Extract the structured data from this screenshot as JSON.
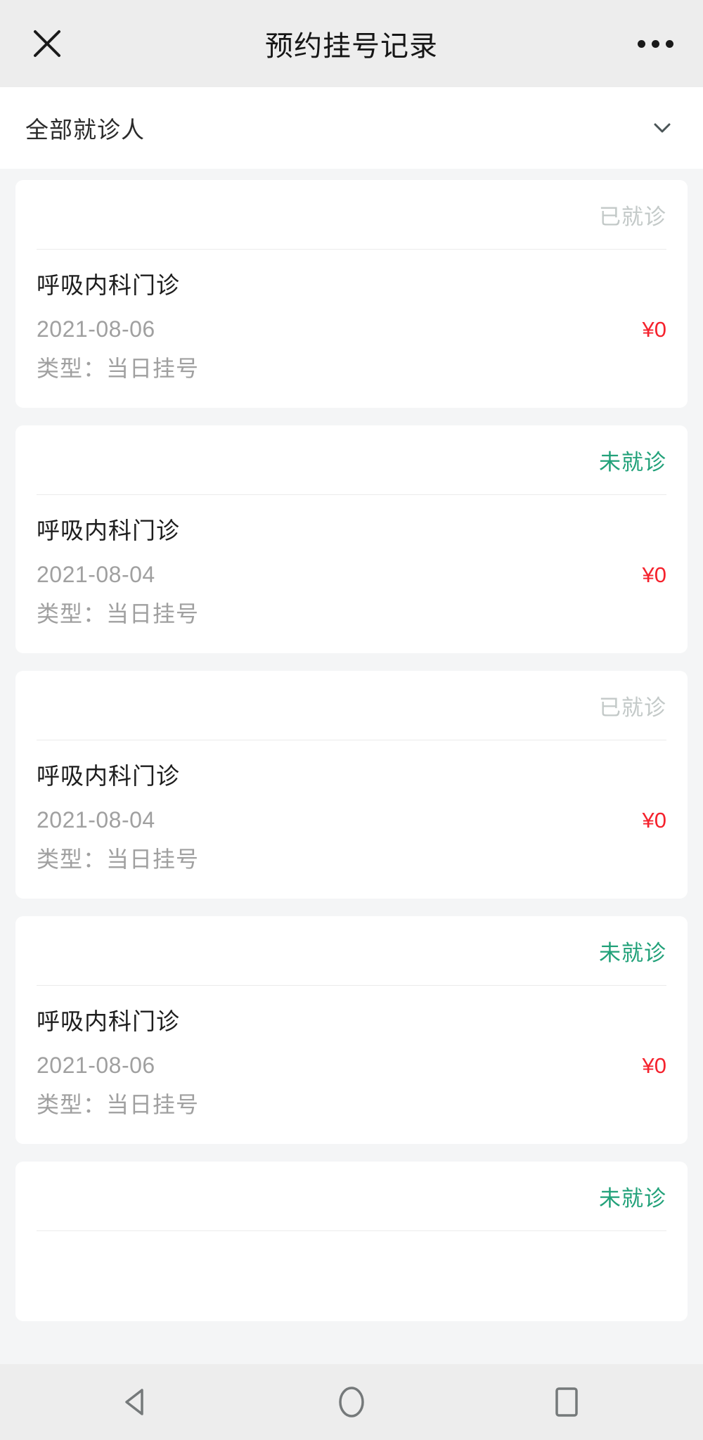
{
  "header": {
    "close_icon": "close-icon",
    "title": "预约挂号记录",
    "more_icon": "more-dots-icon"
  },
  "filter": {
    "label": "全部就诊人",
    "chevron_icon": "chevron-down-icon"
  },
  "colors": {
    "status_done": "#c3c9c8",
    "status_undone": "#21a179",
    "price": "#f5222d",
    "page_background": "#f4f5f6",
    "card_background": "#ffffff",
    "topbar_background": "#ededed"
  },
  "records": [
    {
      "status": "已就诊",
      "status_kind": "done",
      "department": "呼吸内科门诊",
      "date": "2021-08-06",
      "price": "¥0",
      "type": "类型：当日挂号",
      "partial": false
    },
    {
      "status": "未就诊",
      "status_kind": "undone",
      "department": "呼吸内科门诊",
      "date": "2021-08-04",
      "price": "¥0",
      "type": "类型：当日挂号",
      "partial": false
    },
    {
      "status": "已就诊",
      "status_kind": "done",
      "department": "呼吸内科门诊",
      "date": "2021-08-04",
      "price": "¥0",
      "type": "类型：当日挂号",
      "partial": false
    },
    {
      "status": "未就诊",
      "status_kind": "undone",
      "department": "呼吸内科门诊",
      "date": "2021-08-06",
      "price": "¥0",
      "type": "类型：当日挂号",
      "partial": false
    },
    {
      "status": "未就诊",
      "status_kind": "undone",
      "department": "",
      "date": "",
      "price": "",
      "type": "",
      "partial": true
    }
  ],
  "system_nav": {
    "back_icon": "triangle-back-icon",
    "home_icon": "circle-home-icon",
    "recents_icon": "square-recents-icon"
  }
}
